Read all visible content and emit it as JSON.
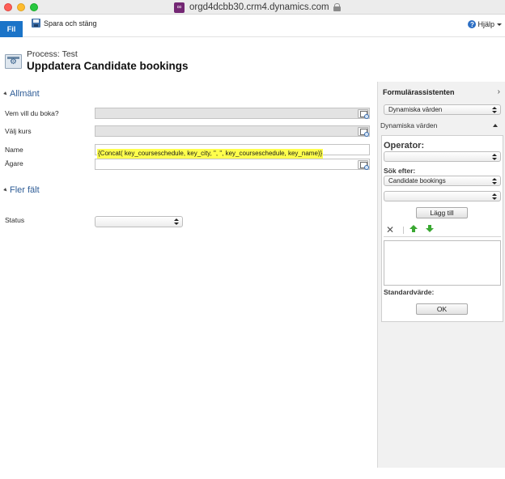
{
  "browser": {
    "url": "orgd4dcbb30.crm4.dynamics.com"
  },
  "ribbon": {
    "file_label": "Fil",
    "save_close_label": "Spara och stäng",
    "help_label": "Hjälp"
  },
  "header": {
    "process_label": "Process: Test",
    "title": "Uppdatera Candidate bookings"
  },
  "sections": {
    "general": "Allmänt",
    "more_fields": "Fler fält"
  },
  "fields": {
    "who_label": "Vem vill du boka?",
    "course_label": "Välj kurs",
    "name_label": "Name",
    "name_value": "{Concat( key_courseschedule, key_city, \", \", key_courseschedule, key_name)}",
    "owner_label": "Ägare",
    "status_label": "Status"
  },
  "assistant": {
    "title": "Formulärassistenten",
    "dynamic_select_value": "Dynamiska värden",
    "dynamic_section_label": "Dynamiska värden",
    "operator_label": "Operator:",
    "search_label": "Sök efter:",
    "search_value": "Candidate bookings",
    "add_button": "Lägg till",
    "default_label": "Standardvärde:",
    "ok_button": "OK"
  }
}
